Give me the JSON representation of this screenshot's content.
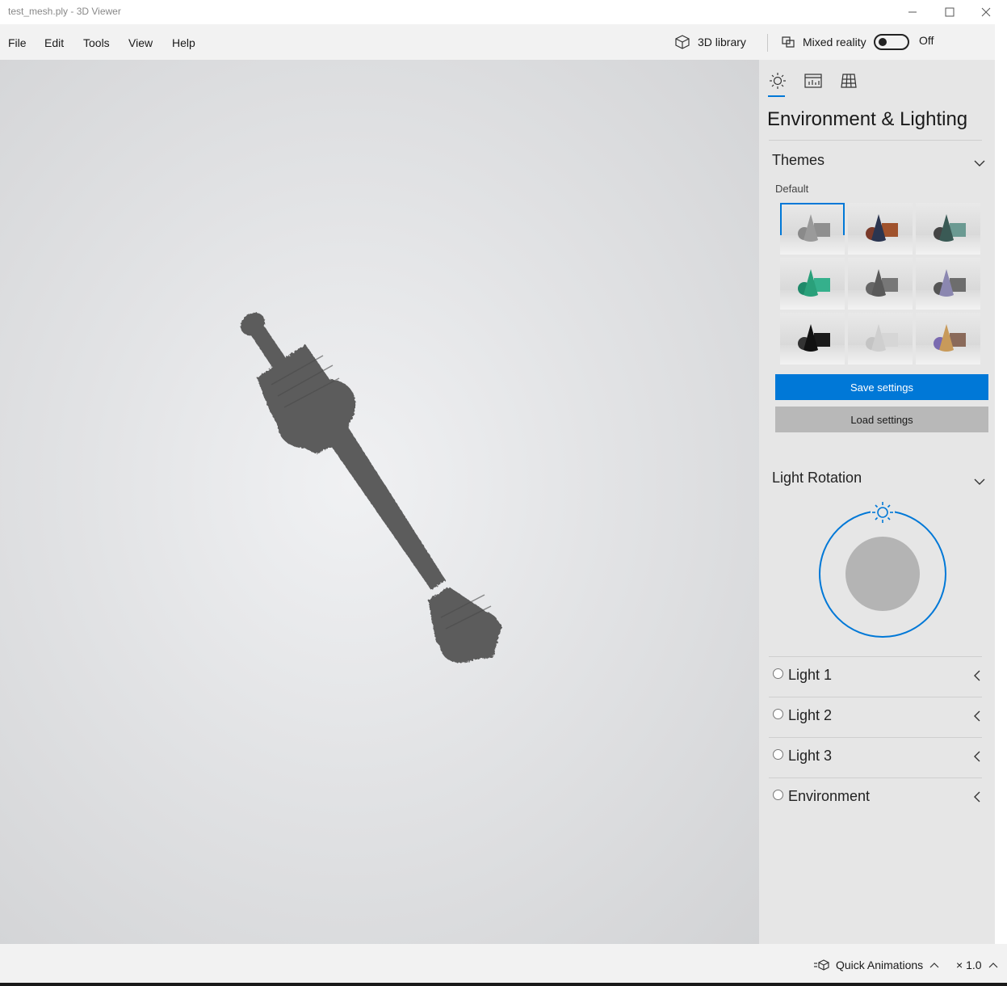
{
  "window": {
    "title": "test_mesh.ply - 3D Viewer",
    "controls": [
      "minimize-icon",
      "maximize-icon",
      "close-icon"
    ]
  },
  "menu": {
    "items": [
      "File",
      "Edit",
      "Tools",
      "View",
      "Help"
    ],
    "library_label": "3D library",
    "mixed_reality_label": "Mixed reality",
    "mixed_reality_state": "Off"
  },
  "panel": {
    "tabs": [
      "lighting-icon",
      "stats-icon",
      "grid-icon"
    ],
    "heading": "Environment & Lighting",
    "themes": {
      "title": "Themes",
      "selected_label": "Default",
      "items": [
        {
          "cone": "#9a9a9a",
          "cube": "#8f8f8f",
          "sphere": "#8a8a8a"
        },
        {
          "cone": "#2b3550",
          "cube": "#a0522d",
          "sphere": "#7a3a2a"
        },
        {
          "cone": "#3a5a55",
          "cube": "#6b9a92",
          "sphere": "#444444"
        },
        {
          "cone": "#2aa07a",
          "cube": "#35b08c",
          "sphere": "#1f8a6a"
        },
        {
          "cone": "#5a5a5a",
          "cube": "#777777",
          "sphere": "#666666"
        },
        {
          "cone": "#8b87b0",
          "cube": "#6d6d6d",
          "sphere": "#555555"
        },
        {
          "cone": "#111111",
          "cube": "#1a1a1a",
          "sphere": "#333333"
        },
        {
          "cone": "#cfcfcf",
          "cube": "#d6d6d6",
          "sphere": "#c4c4c4"
        },
        {
          "cone": "#c89a5a",
          "cube": "#8a6a5a",
          "sphere": "#7a6ab0"
        }
      ]
    },
    "save_label": "Save settings",
    "load_label": "Load settings",
    "rotation_title": "Light Rotation",
    "lights": [
      "Light 1",
      "Light 2",
      "Light 3",
      "Environment"
    ]
  },
  "status": {
    "quick_animations": "Quick Animations",
    "speed": "× 1.0"
  },
  "colors": {
    "accent": "#0078d7",
    "model": "#5a5a5a"
  }
}
